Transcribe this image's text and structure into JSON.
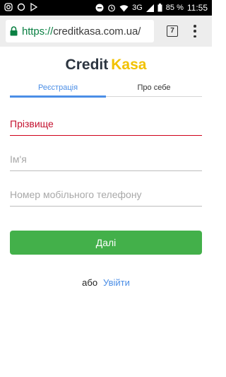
{
  "status_bar": {
    "battery": "85 %",
    "time": "11:55",
    "network": "3G",
    "icons": [
      "instagram-icon",
      "circle-icon",
      "play-icon",
      "minus-circle-icon",
      "alarm-icon",
      "wifi-icon",
      "signal-icon",
      "battery-icon"
    ]
  },
  "browser": {
    "url_scheme": "https://",
    "url_host": "creditkasa.com.ua/",
    "tab_count": "7",
    "lock_color": "#0b8043"
  },
  "logo": {
    "part1": "Credit",
    "part2": "Kasa"
  },
  "tabs": [
    {
      "label": "Реєстрація",
      "active": true
    },
    {
      "label": "Про себе",
      "active": false
    }
  ],
  "form": {
    "surname_placeholder": "Прізвище",
    "name_placeholder": "Ім'я",
    "phone_placeholder": "Номер мобільного телефону",
    "next_label": "Далі"
  },
  "footer": {
    "or_text": "або",
    "login_link": "Увійти"
  },
  "colors": {
    "accent_blue": "#4b8ee6",
    "button_green": "#43b04a",
    "error_red": "#c4122f",
    "logo_yellow": "#f2c200"
  }
}
